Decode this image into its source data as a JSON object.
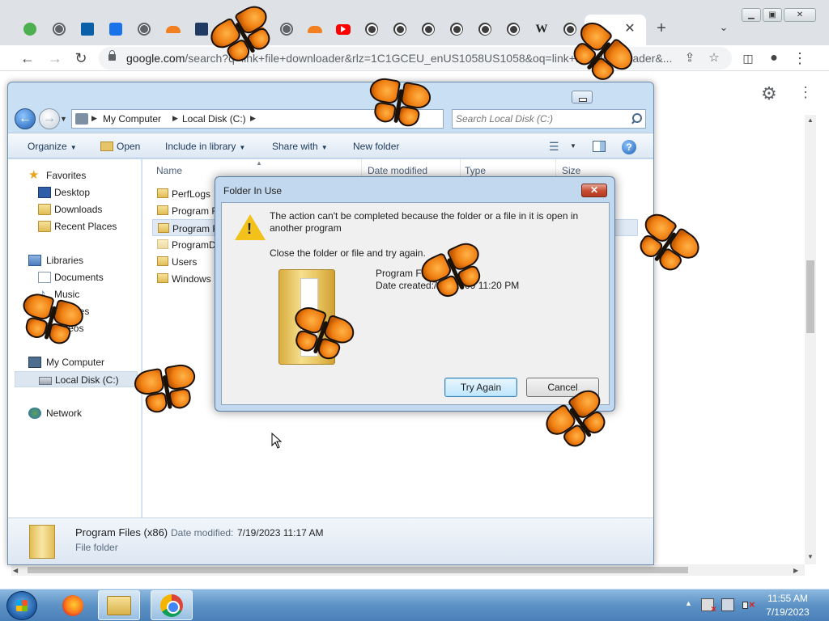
{
  "browser": {
    "url_host": "google.com",
    "url_rest": "/search?q=link+file+downloader&rlz=1C1GCEU_enUS1058US1058&oq=link+file+downloader&...",
    "tabs": [
      {
        "icon": "frog-favicon"
      },
      {
        "icon": "globe-favicon"
      },
      {
        "icon": "chart-favicon"
      },
      {
        "icon": "gear-favicon"
      },
      {
        "icon": "globe-favicon"
      },
      {
        "icon": "cloudflare-favicon"
      },
      {
        "icon": "box-favicon"
      },
      {
        "icon": "github-favicon"
      },
      {
        "icon": "cloudflare-favicon"
      },
      {
        "icon": "globe-favicon"
      },
      {
        "icon": "cloudflare-favicon"
      },
      {
        "icon": "youtube-favicon"
      },
      {
        "icon": "github-favicon"
      },
      {
        "icon": "github-favicon"
      },
      {
        "icon": "github-favicon"
      },
      {
        "icon": "github-favicon"
      },
      {
        "icon": "github-favicon"
      },
      {
        "icon": "github-favicon"
      },
      {
        "icon": "wikipedia-favicon",
        "glyph": "W"
      },
      {
        "icon": "github-favicon"
      },
      {
        "icon": "google-favicon",
        "glyph": "G"
      }
    ]
  },
  "explorer": {
    "breadcrumb": [
      "My Computer",
      "Local Disk (C:)"
    ],
    "search_placeholder": "Search Local Disk (C:)",
    "commands": {
      "organize": "Organize",
      "open": "Open",
      "include_in_library": "Include in library",
      "share_with": "Share with",
      "new_folder": "New folder"
    },
    "nav": {
      "favorites": "Favorites",
      "desktop": "Desktop",
      "downloads": "Downloads",
      "recent_places": "Recent Places",
      "libraries": "Libraries",
      "documents": "Documents",
      "music": "Music",
      "pictures": "Pictures",
      "videos": "Videos",
      "my_computer": "My Computer",
      "local_disk": "Local Disk (C:)",
      "network": "Network"
    },
    "columns": {
      "name": "Name",
      "date_modified": "Date modified",
      "type": "Type",
      "size": "Size"
    },
    "files": [
      "PerfLogs",
      "Program Files",
      "Program Files (x86)",
      "ProgramData",
      "Users",
      "Windows"
    ],
    "details": {
      "name": "Program Files (x86)",
      "date_label": "Date modified:",
      "date_value": "7/19/2023 11:17 AM",
      "type": "File folder"
    }
  },
  "dialog": {
    "title": "Folder In Use",
    "message": "The action can't be completed because the folder or a file in it is open in another program",
    "hint": "Close the folder or file and try again.",
    "file_name": "Program Files",
    "date_label": "Date created:",
    "date_value": "7/14/2009 11:20 PM",
    "try_again": "Try Again",
    "cancel": "Cancel",
    "close_glyph": "✕"
  },
  "taskbar": {
    "time": "11:55 AM",
    "date": "7/19/2023"
  }
}
